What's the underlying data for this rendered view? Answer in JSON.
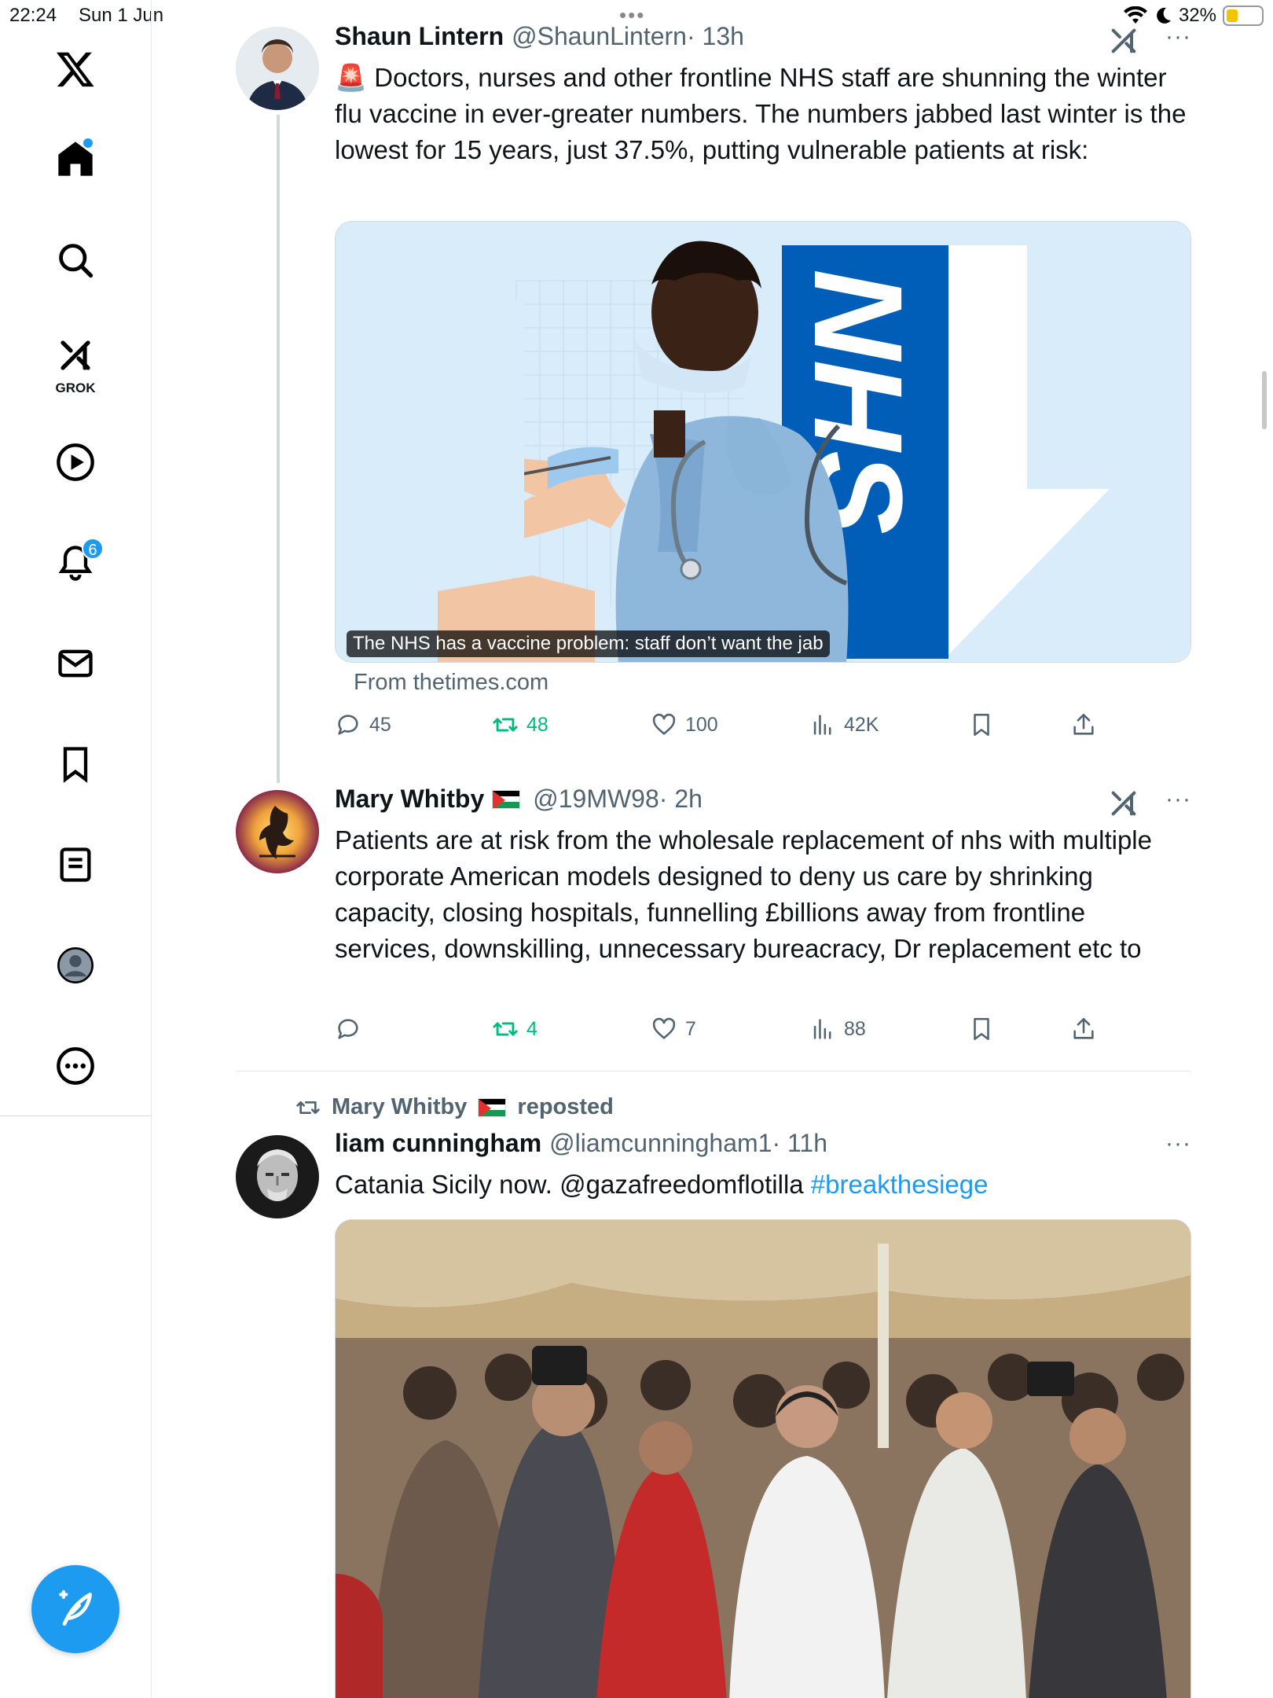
{
  "status_bar": {
    "time": "22:24",
    "date": "Sun 1 Jun",
    "battery": "32%"
  },
  "sidebar": {
    "items": [
      {
        "name": "x-logo"
      },
      {
        "name": "home"
      },
      {
        "name": "search"
      },
      {
        "name": "grok",
        "label": "GROK"
      },
      {
        "name": "video"
      },
      {
        "name": "notifications",
        "badge": "6"
      },
      {
        "name": "messages"
      },
      {
        "name": "bookmarks"
      },
      {
        "name": "lists"
      },
      {
        "name": "profile"
      },
      {
        "name": "more"
      }
    ]
  },
  "tweets": [
    {
      "name": "Shaun Lintern",
      "handle": "@ShaunLintern",
      "time": "· 13h",
      "text": "Doctors, nurses and other frontline NHS staff are shunning the winter flu vaccine in ever-greater numbers. The numbers jabbed last winter is the lowest for 15 years, just 37.5%, putting vulnerable patients at risk:",
      "emoji": "🚨",
      "card": {
        "caption": "The NHS has a vaccine problem: staff don’t want the jab",
        "from": "From thetimes.com",
        "logo_text": "NHS"
      },
      "replies": "45",
      "reposts": "48",
      "likes": "100",
      "views": "42K"
    },
    {
      "name": "Mary Whitby",
      "handle": "@19MW98",
      "time": "· 2h",
      "text": "Patients are at risk from the wholesale replacement of nhs with multiple corporate American models designed to deny us care by shrinking capacity, closing hospitals,  funnelling £billions away from frontline services, downskilling, unnecessary bureacracy, Dr replacement etc to",
      "replies": "",
      "reposts": "4",
      "likes": "7",
      "views": "88"
    },
    {
      "repost_label": "Mary Whitby",
      "repost_suffix": "reposted",
      "name": "liam cunningham",
      "handle": "@liamcunningham1",
      "time": "· 11h",
      "text": "Catania Sicily now. @gazafreedomflotilla ",
      "hashtag": "#breakthesiege"
    }
  ],
  "colors": {
    "accent": "#1d9bf0",
    "repost_green": "#00ba7c",
    "muted": "#536471",
    "nhs_blue": "#005eb8"
  }
}
